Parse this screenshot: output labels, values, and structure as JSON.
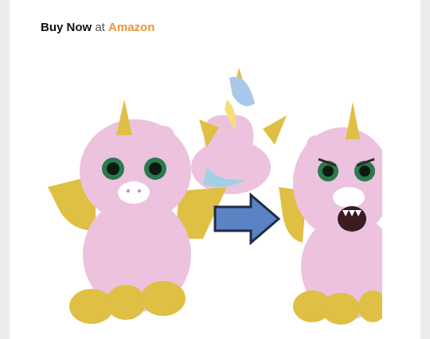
{
  "promo": {
    "buy_label": "Buy Now",
    "at_label": "at",
    "store_label": "Amazon"
  },
  "product_image": {
    "alt": "Pink winged unicorn plush shown calm, from behind, and with a scary face"
  },
  "colors": {
    "accent": "#e8963a",
    "plush_pink": "#ecc2df",
    "wing_gold": "#e0bf45",
    "arrow_blue": "#5b82c4"
  }
}
